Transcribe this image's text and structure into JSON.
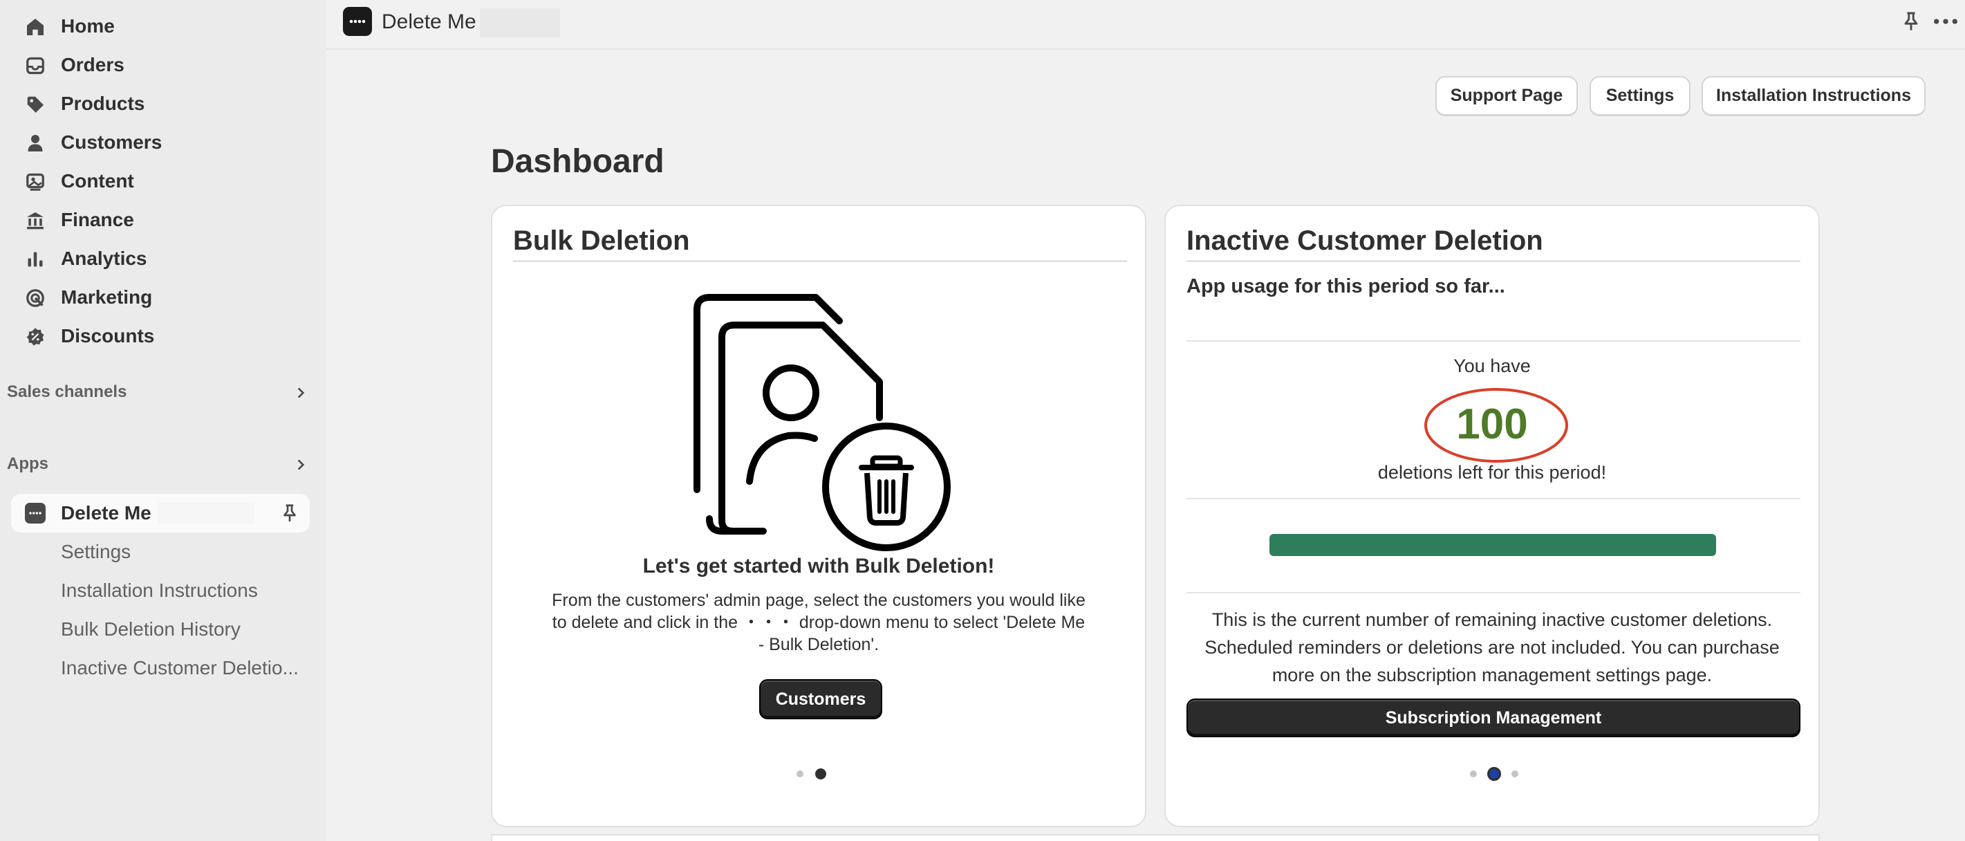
{
  "sidebar": {
    "nav": [
      {
        "label": "Home",
        "icon": "home-icon"
      },
      {
        "label": "Orders",
        "icon": "inbox-icon"
      },
      {
        "label": "Products",
        "icon": "tag-icon"
      },
      {
        "label": "Customers",
        "icon": "person-icon"
      },
      {
        "label": "Content",
        "icon": "image-icon"
      },
      {
        "label": "Finance",
        "icon": "bank-icon"
      },
      {
        "label": "Analytics",
        "icon": "bar-chart-icon"
      },
      {
        "label": "Marketing",
        "icon": "target-icon"
      },
      {
        "label": "Discounts",
        "icon": "discount-icon"
      }
    ],
    "sales_channels_label": "Sales channels",
    "apps_label": "Apps",
    "app": {
      "label": "Delete Me",
      "sub_items": [
        "Settings",
        "Installation Instructions",
        "Bulk Deletion History",
        "Inactive Customer Deletio..."
      ]
    }
  },
  "topbar": {
    "title": "Delete Me"
  },
  "header": {
    "buttons": [
      "Support Page",
      "Settings",
      "Installation Instructions"
    ]
  },
  "page_title": "Dashboard",
  "bulk_card": {
    "title": "Bulk Deletion",
    "heading": "Let's get started with Bulk Deletion!",
    "body_line1": "From the customers' admin page, select the customers you would like",
    "body_line2": "to delete and click in the  ・・・  drop-down menu to select 'Delete Me",
    "body_line3": "- Bulk Deletion'.",
    "button": "Customers",
    "pagination": {
      "total": 2,
      "active": 1
    }
  },
  "inactive_card": {
    "title": "Inactive Customer Deletion",
    "subtitle": "App usage for this period so far...",
    "you_have": "You have",
    "count": "100",
    "deletions_left": "deletions left for this period!",
    "usage_fraction": 1.0,
    "body_line1": "This is the current number of remaining inactive customer deletions.",
    "body_line2": "Scheduled reminders or deletions are not included. You can purchase",
    "body_line3": "more on the subscription management settings page.",
    "button": "Subscription Management",
    "pagination": {
      "total": 3,
      "active": 1
    }
  },
  "colors": {
    "count_green": "#4f7a28",
    "circle_red": "#d9402b",
    "bar_green": "#2e7d5b",
    "active_dot_blue": "#1f3fa6"
  }
}
